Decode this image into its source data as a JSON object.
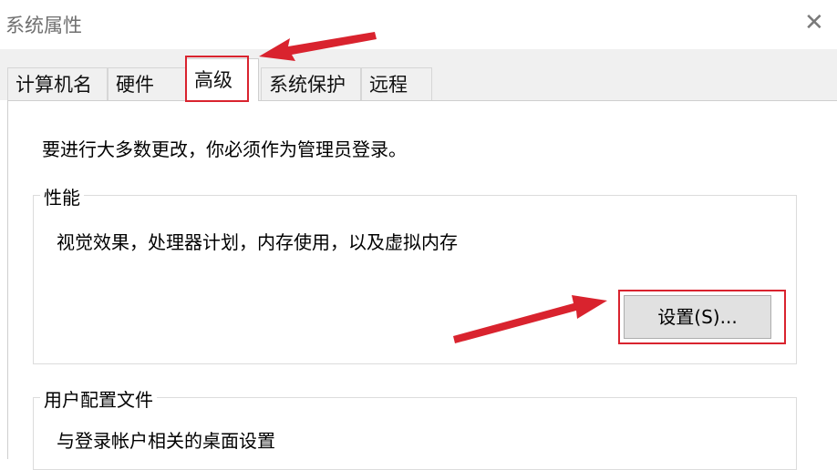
{
  "window": {
    "title": "系统属性",
    "close_glyph": "✕"
  },
  "tabs": [
    {
      "label": "计算机名"
    },
    {
      "label": "硬件"
    },
    {
      "label": "高级",
      "active": true
    },
    {
      "label": "系统保护"
    },
    {
      "label": "远程"
    }
  ],
  "notice": "要进行大多数更改，你必须作为管理员登录。",
  "performance": {
    "legend": "性能",
    "description": "视觉效果，处理器计划，内存使用，以及虚拟内存",
    "settings_button": "设置(S)..."
  },
  "user_profiles": {
    "legend": "用户配置文件",
    "description": "与登录帐户相关的桌面设置"
  },
  "annotation_color": "#d9232e"
}
